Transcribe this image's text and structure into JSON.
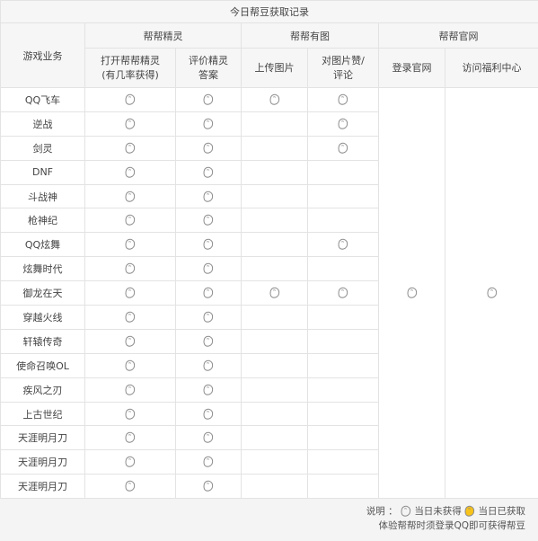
{
  "title": "今日帮豆获取记录",
  "game_column_header": "游戏业务",
  "groups": [
    {
      "label": "帮帮精灵",
      "subs": [
        {
          "label": "打开帮帮精灵",
          "sub": "(有几率获得)"
        },
        {
          "label": "评价精灵",
          "sub": "答案"
        }
      ]
    },
    {
      "label": "帮帮有图",
      "subs": [
        {
          "label": "上传图片",
          "sub": ""
        },
        {
          "label": "对图片赞/",
          "sub": "评论"
        }
      ]
    },
    {
      "label": "帮帮官网",
      "subs": [
        {
          "label": "登录官网",
          "sub": ""
        },
        {
          "label": "访问福利中心",
          "sub": ""
        }
      ]
    }
  ],
  "rows": [
    {
      "game": "QQ飞车",
      "open": true,
      "rate": true,
      "upload": true,
      "comment": true
    },
    {
      "game": "逆战",
      "open": true,
      "rate": true,
      "upload": false,
      "comment": true
    },
    {
      "game": "剑灵",
      "open": true,
      "rate": true,
      "upload": false,
      "comment": true
    },
    {
      "game": "DNF",
      "open": true,
      "rate": true,
      "upload": false,
      "comment": false
    },
    {
      "game": "斗战神",
      "open": true,
      "rate": true,
      "upload": false,
      "comment": false
    },
    {
      "game": "枪神纪",
      "open": true,
      "rate": true,
      "upload": false,
      "comment": false
    },
    {
      "game": "QQ炫舞",
      "open": true,
      "rate": true,
      "upload": false,
      "comment": true
    },
    {
      "game": "炫舞时代",
      "open": true,
      "rate": true,
      "upload": false,
      "comment": false
    },
    {
      "game": "御龙在天",
      "open": true,
      "rate": true,
      "upload": true,
      "comment": true
    },
    {
      "game": "穿越火线",
      "open": true,
      "rate": true,
      "upload": false,
      "comment": false
    },
    {
      "game": "轩辕传奇",
      "open": true,
      "rate": true,
      "upload": false,
      "comment": false
    },
    {
      "game": "使命召唤OL",
      "open": true,
      "rate": true,
      "upload": false,
      "comment": false
    },
    {
      "game": "疾风之刃",
      "open": true,
      "rate": true,
      "upload": false,
      "comment": false
    },
    {
      "game": "上古世纪",
      "open": true,
      "rate": true,
      "upload": false,
      "comment": false
    },
    {
      "game": "天涯明月刀",
      "open": true,
      "rate": true,
      "upload": false,
      "comment": false
    },
    {
      "game": "天涯明月刀",
      "open": true,
      "rate": true,
      "upload": false,
      "comment": false
    },
    {
      "game": "天涯明月刀",
      "open": true,
      "rate": true,
      "upload": false,
      "comment": false
    }
  ],
  "official_site": {
    "login": true,
    "welfare": true
  },
  "legend": {
    "prefix": "说明 ：",
    "not_obtained": "当日未获得",
    "obtained": "当日已获取",
    "note": "体验帮帮时须登录QQ即可获得帮豆"
  },
  "colors": {
    "bean_outline": "#8c8c8c",
    "bean_filled": "#f7c21a",
    "border": "#e3e3e3",
    "header_bg": "#f6f6f6"
  },
  "icons": {
    "empty": "bean-outline-icon",
    "filled": "bean-filled-icon"
  }
}
